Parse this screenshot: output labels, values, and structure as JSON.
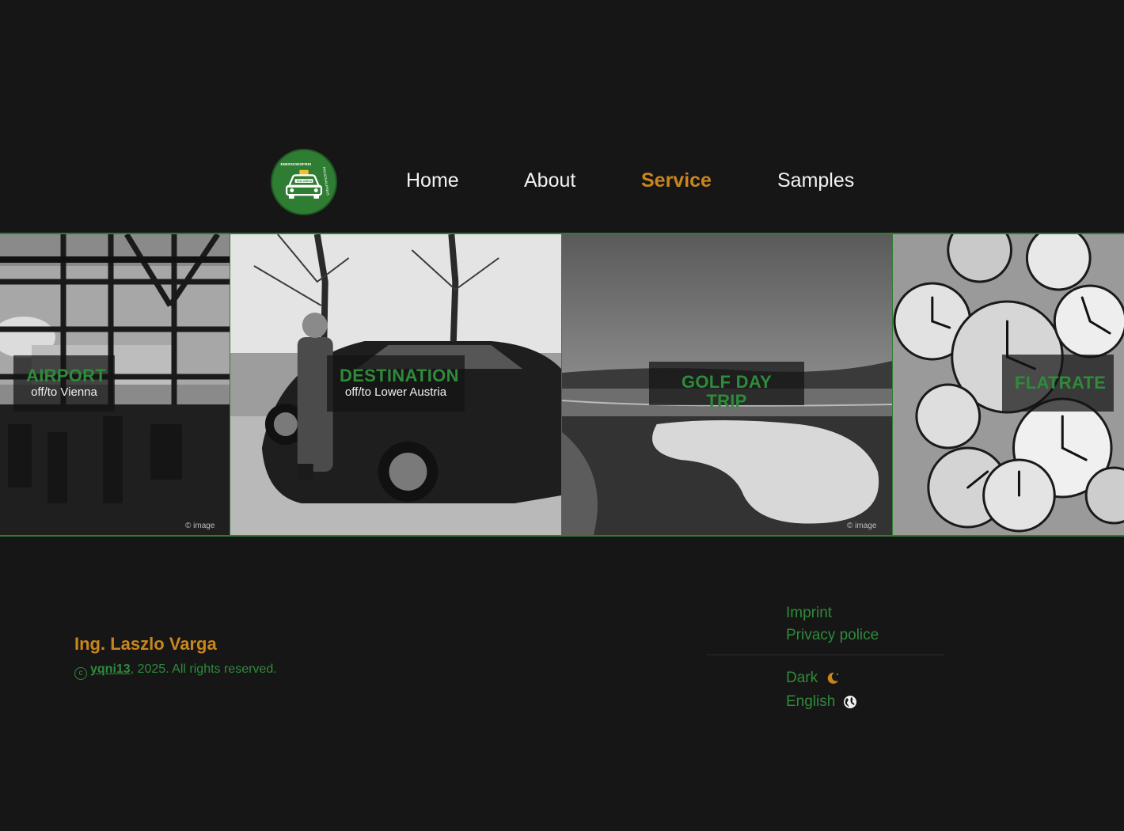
{
  "header": {
    "logo": {
      "top_text": "EMISSIONSFREI",
      "side_text": "PAUSCHALPREIS",
      "plate_text": "TAXI-VARGA"
    },
    "nav": [
      {
        "label": "Home"
      },
      {
        "label": "About"
      },
      {
        "label": "Service",
        "active": true
      },
      {
        "label": "Samples"
      }
    ]
  },
  "services": [
    {
      "title": "AIRPORT",
      "subtitle": "off/to Vienna",
      "credit": "© image"
    },
    {
      "title": "DESTINATION",
      "subtitle": "off/to Lower Austria"
    },
    {
      "title": "GOLF DAY TRIP",
      "credit": "© image"
    },
    {
      "title": "FLATRATE"
    }
  ],
  "footer": {
    "owner": "Ing. Laszlo Varga",
    "copyright_symbol": "c",
    "copyright_link": "yqni13",
    "copyright_text": ", 2025. All rights reserved.",
    "links": [
      "Imprint",
      "Privacy police"
    ],
    "theme_label": "Dark",
    "language_label": "English"
  },
  "colors": {
    "background": "#161616",
    "accent": "#c9861c",
    "brand_green": "#2e8b3a",
    "text": "#f2f2f2"
  },
  "icons": {
    "theme": "moon-icon",
    "language": "globe-icon"
  }
}
